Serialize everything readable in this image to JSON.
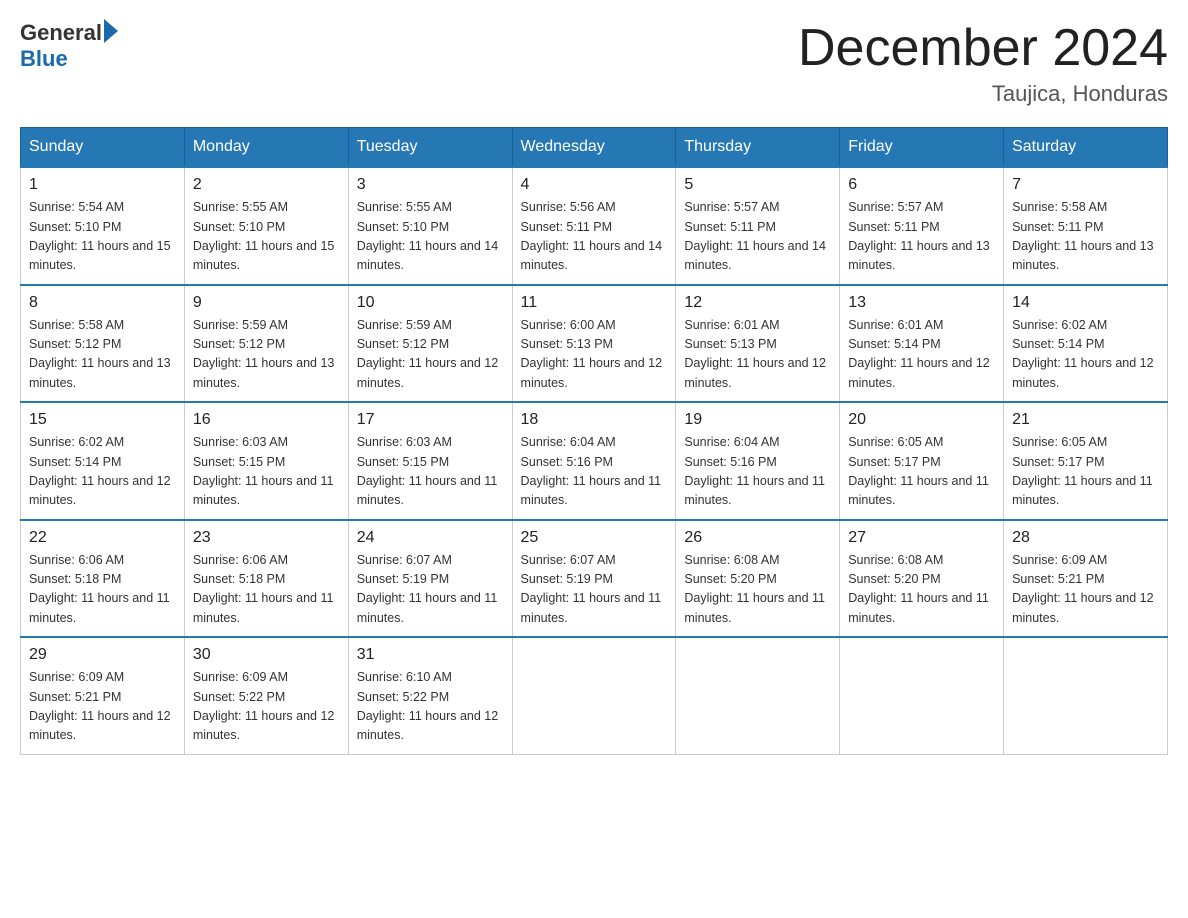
{
  "logo": {
    "text_general": "General",
    "text_blue": "Blue"
  },
  "title": {
    "month": "December 2024",
    "location": "Taujica, Honduras"
  },
  "weekdays": [
    "Sunday",
    "Monday",
    "Tuesday",
    "Wednesday",
    "Thursday",
    "Friday",
    "Saturday"
  ],
  "weeks": [
    [
      {
        "day": "1",
        "sunrise": "5:54 AM",
        "sunset": "5:10 PM",
        "daylight": "11 hours and 15 minutes."
      },
      {
        "day": "2",
        "sunrise": "5:55 AM",
        "sunset": "5:10 PM",
        "daylight": "11 hours and 15 minutes."
      },
      {
        "day": "3",
        "sunrise": "5:55 AM",
        "sunset": "5:10 PM",
        "daylight": "11 hours and 14 minutes."
      },
      {
        "day": "4",
        "sunrise": "5:56 AM",
        "sunset": "5:11 PM",
        "daylight": "11 hours and 14 minutes."
      },
      {
        "day": "5",
        "sunrise": "5:57 AM",
        "sunset": "5:11 PM",
        "daylight": "11 hours and 14 minutes."
      },
      {
        "day": "6",
        "sunrise": "5:57 AM",
        "sunset": "5:11 PM",
        "daylight": "11 hours and 13 minutes."
      },
      {
        "day": "7",
        "sunrise": "5:58 AM",
        "sunset": "5:11 PM",
        "daylight": "11 hours and 13 minutes."
      }
    ],
    [
      {
        "day": "8",
        "sunrise": "5:58 AM",
        "sunset": "5:12 PM",
        "daylight": "11 hours and 13 minutes."
      },
      {
        "day": "9",
        "sunrise": "5:59 AM",
        "sunset": "5:12 PM",
        "daylight": "11 hours and 13 minutes."
      },
      {
        "day": "10",
        "sunrise": "5:59 AM",
        "sunset": "5:12 PM",
        "daylight": "11 hours and 12 minutes."
      },
      {
        "day": "11",
        "sunrise": "6:00 AM",
        "sunset": "5:13 PM",
        "daylight": "11 hours and 12 minutes."
      },
      {
        "day": "12",
        "sunrise": "6:01 AM",
        "sunset": "5:13 PM",
        "daylight": "11 hours and 12 minutes."
      },
      {
        "day": "13",
        "sunrise": "6:01 AM",
        "sunset": "5:14 PM",
        "daylight": "11 hours and 12 minutes."
      },
      {
        "day": "14",
        "sunrise": "6:02 AM",
        "sunset": "5:14 PM",
        "daylight": "11 hours and 12 minutes."
      }
    ],
    [
      {
        "day": "15",
        "sunrise": "6:02 AM",
        "sunset": "5:14 PM",
        "daylight": "11 hours and 12 minutes."
      },
      {
        "day": "16",
        "sunrise": "6:03 AM",
        "sunset": "5:15 PM",
        "daylight": "11 hours and 11 minutes."
      },
      {
        "day": "17",
        "sunrise": "6:03 AM",
        "sunset": "5:15 PM",
        "daylight": "11 hours and 11 minutes."
      },
      {
        "day": "18",
        "sunrise": "6:04 AM",
        "sunset": "5:16 PM",
        "daylight": "11 hours and 11 minutes."
      },
      {
        "day": "19",
        "sunrise": "6:04 AM",
        "sunset": "5:16 PM",
        "daylight": "11 hours and 11 minutes."
      },
      {
        "day": "20",
        "sunrise": "6:05 AM",
        "sunset": "5:17 PM",
        "daylight": "11 hours and 11 minutes."
      },
      {
        "day": "21",
        "sunrise": "6:05 AM",
        "sunset": "5:17 PM",
        "daylight": "11 hours and 11 minutes."
      }
    ],
    [
      {
        "day": "22",
        "sunrise": "6:06 AM",
        "sunset": "5:18 PM",
        "daylight": "11 hours and 11 minutes."
      },
      {
        "day": "23",
        "sunrise": "6:06 AM",
        "sunset": "5:18 PM",
        "daylight": "11 hours and 11 minutes."
      },
      {
        "day": "24",
        "sunrise": "6:07 AM",
        "sunset": "5:19 PM",
        "daylight": "11 hours and 11 minutes."
      },
      {
        "day": "25",
        "sunrise": "6:07 AM",
        "sunset": "5:19 PM",
        "daylight": "11 hours and 11 minutes."
      },
      {
        "day": "26",
        "sunrise": "6:08 AM",
        "sunset": "5:20 PM",
        "daylight": "11 hours and 11 minutes."
      },
      {
        "day": "27",
        "sunrise": "6:08 AM",
        "sunset": "5:20 PM",
        "daylight": "11 hours and 11 minutes."
      },
      {
        "day": "28",
        "sunrise": "6:09 AM",
        "sunset": "5:21 PM",
        "daylight": "11 hours and 12 minutes."
      }
    ],
    [
      {
        "day": "29",
        "sunrise": "6:09 AM",
        "sunset": "5:21 PM",
        "daylight": "11 hours and 12 minutes."
      },
      {
        "day": "30",
        "sunrise": "6:09 AM",
        "sunset": "5:22 PM",
        "daylight": "11 hours and 12 minutes."
      },
      {
        "day": "31",
        "sunrise": "6:10 AM",
        "sunset": "5:22 PM",
        "daylight": "11 hours and 12 minutes."
      },
      null,
      null,
      null,
      null
    ]
  ]
}
